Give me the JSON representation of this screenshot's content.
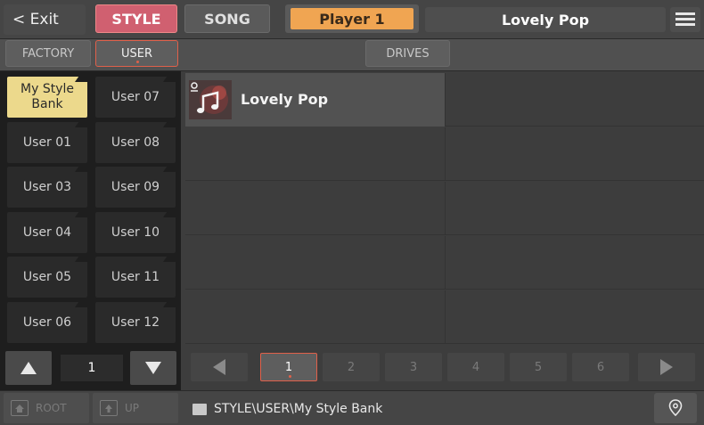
{
  "header": {
    "exit_label": "< Exit",
    "tabs": {
      "style": "STYLE",
      "song": "SONG"
    },
    "player": "Player 1",
    "current_song": "Lovely Pop"
  },
  "source_tabs": {
    "factory": "FACTORY",
    "user": "USER",
    "drives": "DRIVES"
  },
  "banks": [
    {
      "label": "My Style Bank",
      "selected": true
    },
    {
      "label": "User 07"
    },
    {
      "label": "User 01"
    },
    {
      "label": "User 08"
    },
    {
      "label": "User 03"
    },
    {
      "label": "User 09"
    },
    {
      "label": "User 04"
    },
    {
      "label": "User 10"
    },
    {
      "label": "User 05"
    },
    {
      "label": "User 11"
    },
    {
      "label": "User 06"
    },
    {
      "label": "User 12"
    }
  ],
  "bank_page": "1",
  "files": [
    {
      "name": "Lovely Pop",
      "icon": "style-music-icon"
    }
  ],
  "pager": {
    "pages": [
      "1",
      "2",
      "3",
      "4",
      "5",
      "6"
    ],
    "current": "1"
  },
  "footer": {
    "root_label": "ROOT",
    "up_label": "UP",
    "path": "STYLE\\USER\\My Style Bank"
  },
  "colors": {
    "accent": "#e0604a",
    "style_tab": "#d06070",
    "player": "#f0a552",
    "selected_bank": "#ecd98c"
  }
}
